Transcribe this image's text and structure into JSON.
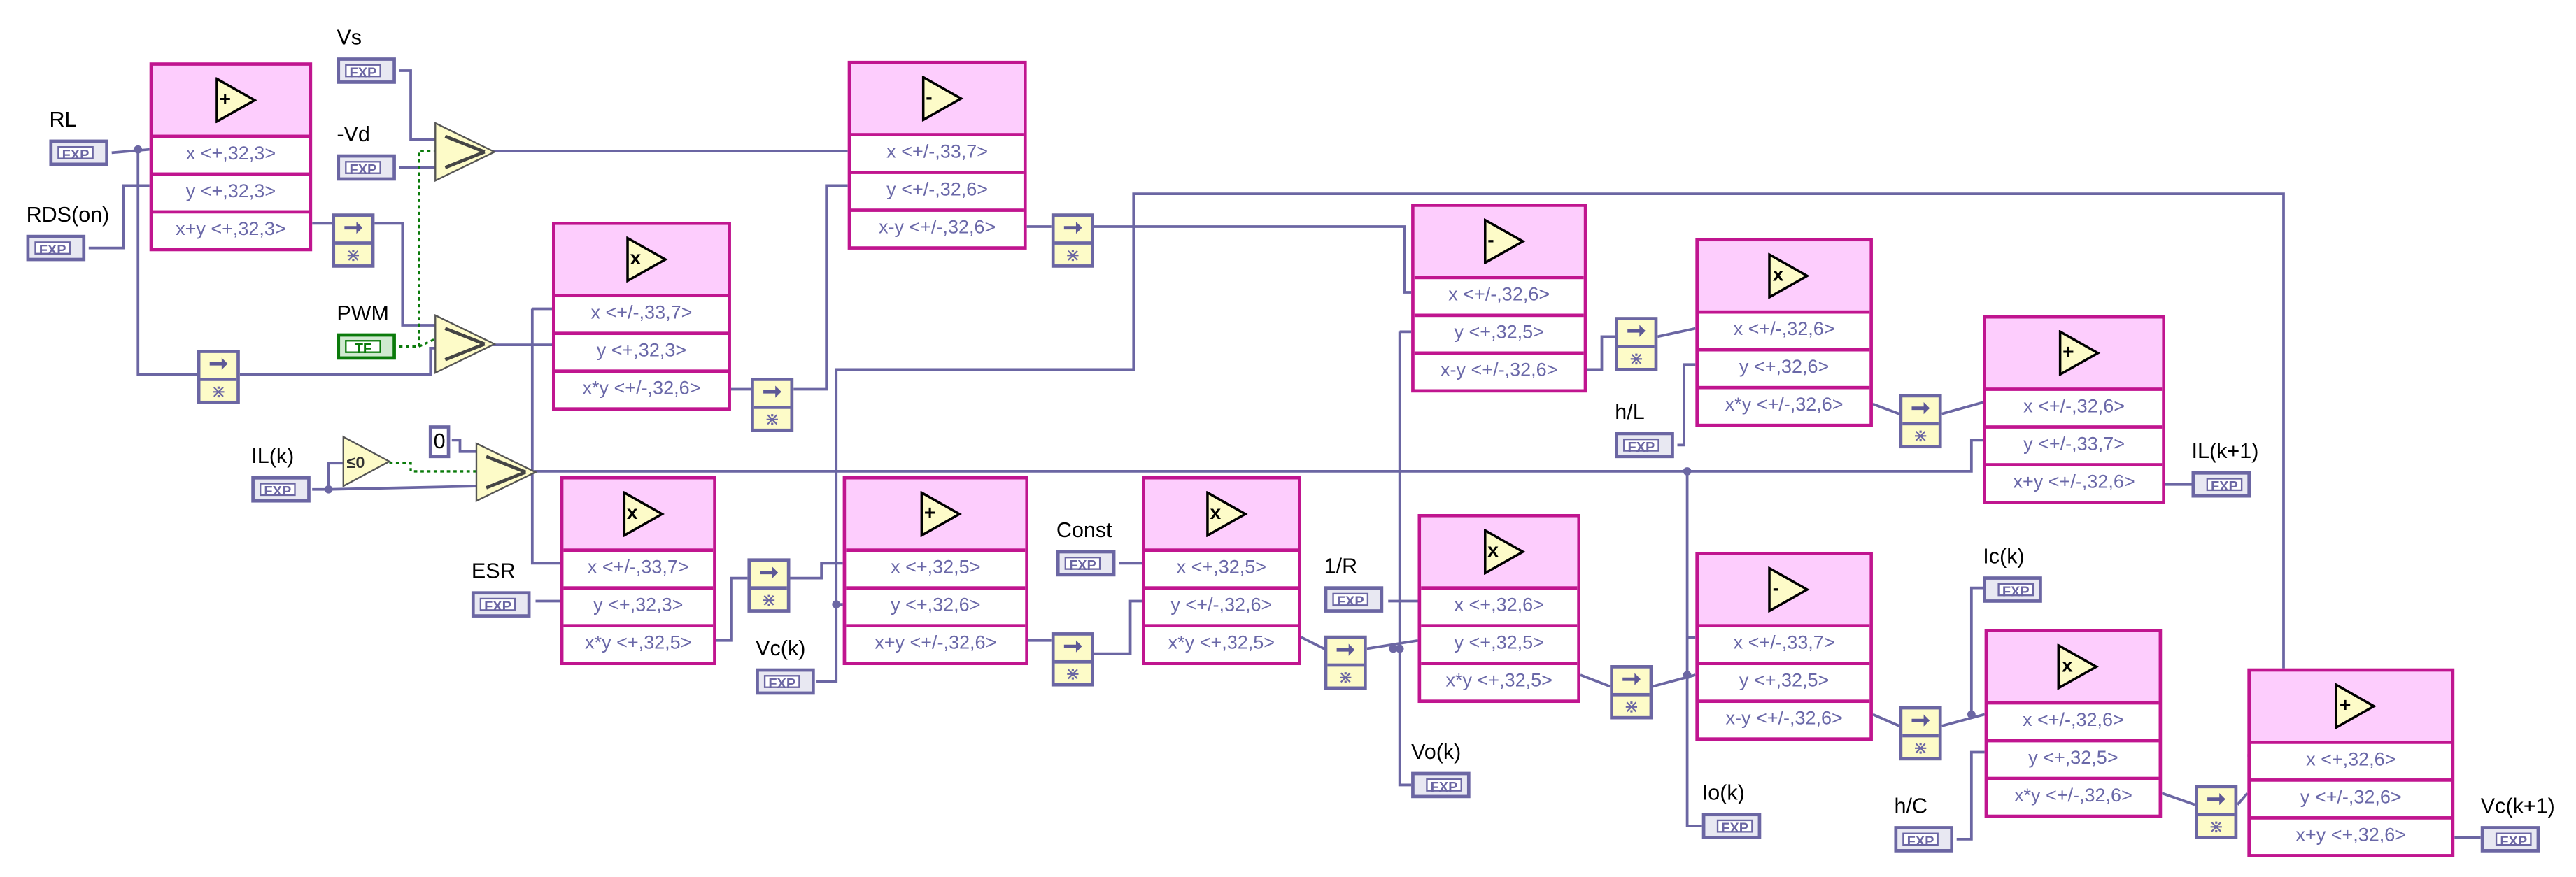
{
  "colors": {
    "wire": "#6b66a3",
    "bool_wire": "#0a7a0a",
    "block_border": "#c0158f",
    "block_header": "#fdcdfd",
    "node_fill": "#fdfbc8"
  },
  "controls": [
    {
      "id": "RL",
      "label": "RL",
      "type": "FXP"
    },
    {
      "id": "RDS",
      "label": "RDS(on)",
      "type": "FXP"
    },
    {
      "id": "Vs",
      "label": "Vs",
      "type": "FXP"
    },
    {
      "id": "Vd",
      "label": "-Vd",
      "type": "FXP"
    },
    {
      "id": "PWM",
      "label": "PWM",
      "type": "TF"
    },
    {
      "id": "ILk",
      "label": "IL(k)",
      "type": "FXP"
    },
    {
      "id": "ESR",
      "label": "ESR",
      "type": "FXP"
    },
    {
      "id": "Vck",
      "label": "Vc(k)",
      "type": "FXP"
    },
    {
      "id": "Const",
      "label": "Const",
      "type": "FXP"
    },
    {
      "id": "invR",
      "label": "1/R",
      "type": "FXP"
    },
    {
      "id": "hL",
      "label": "h/L",
      "type": "FXP"
    },
    {
      "id": "hC",
      "label": "h/C",
      "type": "FXP"
    }
  ],
  "indicators": [
    {
      "id": "ILk1",
      "label": "IL(k+1)",
      "type": "FXP"
    },
    {
      "id": "Ick",
      "label": "Ic(k)",
      "type": "FXP"
    },
    {
      "id": "Vok",
      "label": "Vo(k)",
      "type": "FXP"
    },
    {
      "id": "Iok",
      "label": "Io(k)",
      "type": "FXP"
    },
    {
      "id": "Vck1",
      "label": "Vc(k+1)",
      "type": "FXP"
    }
  ],
  "constant_zero": "0",
  "compare_node": "≤0",
  "blocks": [
    {
      "op": "+",
      "rows": [
        "x <+,32,3>",
        "y <+,32,3>",
        "x+y <+,32,3>"
      ]
    },
    {
      "op": "-",
      "rows": [
        "x <+/-,33,7>",
        "y <+/-,32,6>",
        "x-y <+/-,32,6>"
      ]
    },
    {
      "op": "x",
      "rows": [
        "x <+/-,33,7>",
        "y <+,32,3>",
        "x*y <+/-,32,6>"
      ]
    },
    {
      "op": "x",
      "rows": [
        "x <+/-,33,7>",
        "y <+,32,3>",
        "x*y <+,32,5>"
      ]
    },
    {
      "op": "+",
      "rows": [
        "x <+,32,5>",
        "y <+,32,6>",
        "x+y <+/-,32,6>"
      ]
    },
    {
      "op": "x",
      "rows": [
        "x <+,32,5>",
        "y <+/-,32,6>",
        "x*y <+,32,5>"
      ]
    },
    {
      "op": "-",
      "rows": [
        "x <+/-,32,6>",
        "y <+,32,5>",
        "x-y <+/-,32,6>"
      ]
    },
    {
      "op": "x",
      "rows": [
        "x <+/-,32,6>",
        "y <+,32,6>",
        "x*y <+/-,32,6>"
      ]
    },
    {
      "op": "+",
      "rows": [
        "x <+/-,32,6>",
        "y <+/-,33,7>",
        "x+y <+/-,32,6>"
      ]
    },
    {
      "op": "x",
      "rows": [
        "x <+,32,6>",
        "y <+,32,5>",
        "x*y <+,32,5>"
      ]
    },
    {
      "op": "-",
      "rows": [
        "x <+/-,33,7>",
        "y <+,32,5>",
        "x-y <+/-,32,6>"
      ]
    },
    {
      "op": "x",
      "rows": [
        "x <+/-,32,6>",
        "y <+,32,5>",
        "x*y <+/-,32,6>"
      ]
    },
    {
      "op": "+",
      "rows": [
        "x <+,32,6>",
        "y <+/-,32,6>",
        "x+y <+,32,6>"
      ]
    }
  ]
}
